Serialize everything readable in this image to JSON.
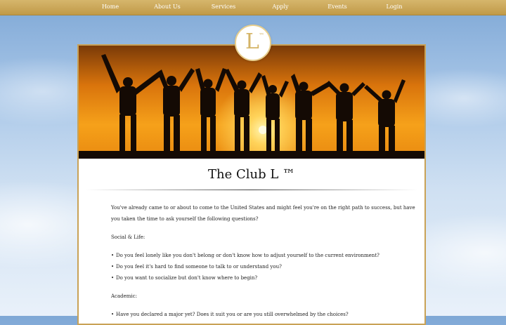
{
  "nav": {
    "items": [
      "Home",
      "About Us",
      "Services",
      "Apply",
      "Events",
      "Login"
    ]
  },
  "logo": {
    "letter": "L",
    "mark": "™"
  },
  "hero": {
    "icon": "people-sunset-silhouette-image"
  },
  "main": {
    "title": "The Club L ™",
    "intro_line1": "You've already came to or about to come to the United States and might feel you're on the right path to success, but have",
    "intro_line2": "you taken the time to ask yourself the following questions?",
    "social_heading": "Social & Life:",
    "social_items": [
      "Do you feel lonely like you don't belong or don't know how to adjust yourself to the current environment?",
      "Do you feel it's hard to find someone to talk to or understand you?",
      "Do you want to socialize but don't know where to begin?"
    ],
    "academic_heading": "Academic:",
    "academic_items": [
      "Have you declared a major yet? Does it suit you or are you still overwhelmed by the choices?"
    ]
  },
  "colors": {
    "accent": "#c9a256",
    "nav_bg": "#c9a556",
    "logo_gold": "#d4b467"
  }
}
